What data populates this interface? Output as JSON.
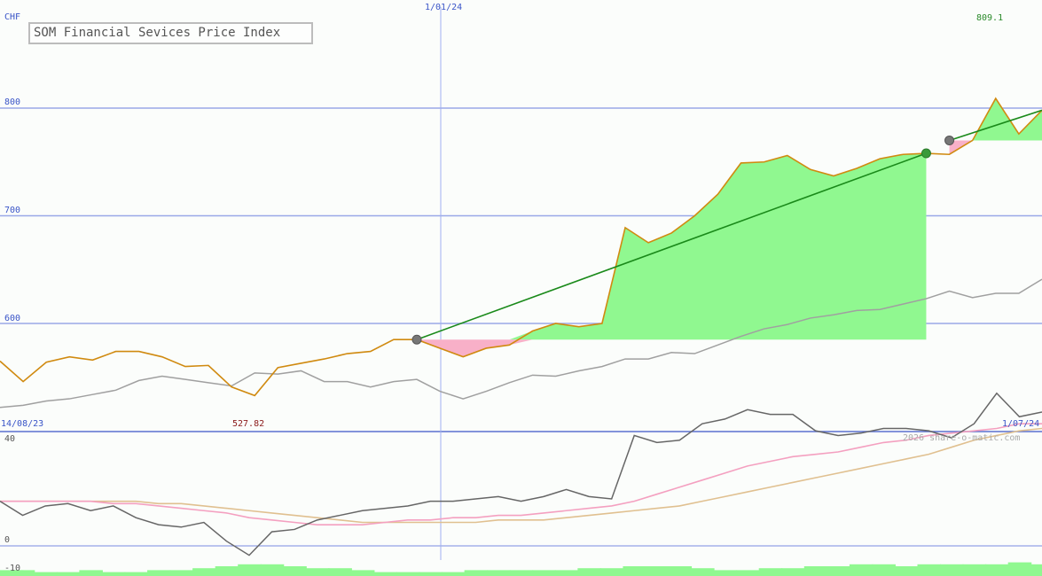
{
  "chart_data": {
    "type": "line",
    "title": "SOM Financial Sevices Price Index",
    "currency": "CHF",
    "watermark": "2026 share-o-matic.com",
    "x_start_label": "14/08/23",
    "x_mid_label": "1/01/24",
    "x_end_label": "1/07/24",
    "low_label": "527.82",
    "high_label": "809.1",
    "price_panel": {
      "y_ticks": [
        "600",
        "700",
        "800"
      ],
      "ylim": [
        504,
        900
      ],
      "price": [
        565,
        546,
        564,
        569,
        566,
        574,
        574,
        569,
        560,
        561,
        541,
        533,
        559,
        563,
        567,
        572,
        574,
        585,
        585,
        577,
        569,
        577,
        580,
        593,
        600,
        597,
        600,
        689,
        675,
        684,
        700,
        720,
        749,
        750,
        756,
        743,
        737,
        744,
        753,
        757,
        758,
        757,
        770,
        809,
        776,
        798
      ],
      "comparison": [
        522,
        524,
        528,
        530,
        534,
        538,
        547,
        551,
        548,
        545,
        542,
        554,
        553,
        556,
        546,
        546,
        541,
        546,
        548,
        537,
        530,
        537,
        545,
        552,
        551,
        556,
        560,
        567,
        567,
        573,
        572,
        580,
        588,
        595,
        599,
        605,
        608,
        612,
        613,
        618,
        623,
        630,
        624,
        628,
        628,
        641
      ],
      "trend_segments": [
        {
          "from_index": 18,
          "to_index": 40,
          "from": 585,
          "to": 758
        },
        {
          "from_index": 41,
          "to_index": 45,
          "from": 770,
          "to": 798
        }
      ]
    },
    "indicator_panel": {
      "y_ticks": [
        "40",
        "0",
        "-10"
      ],
      "oscillator": [
        19,
        13,
        17,
        18,
        15,
        17,
        12,
        9,
        8,
        10,
        2,
        -4,
        6,
        7,
        11,
        13,
        15,
        16,
        17,
        19,
        19,
        20,
        21,
        19,
        21,
        24,
        21,
        20,
        47,
        44,
        45,
        52,
        54,
        58,
        56,
        56,
        49,
        47,
        48,
        50,
        50,
        49,
        46,
        52,
        65,
        55,
        57
      ],
      "signal_fast": [
        19,
        19,
        19,
        19,
        19,
        18,
        18,
        17,
        16,
        15,
        14,
        12,
        11,
        10,
        9,
        9,
        9,
        10,
        11,
        11,
        12,
        12,
        13,
        13,
        14,
        15,
        16,
        17,
        19,
        22,
        25,
        28,
        31,
        34,
        36,
        38,
        39,
        40,
        42,
        44,
        45,
        47,
        48,
        49,
        50,
        52,
        52
      ],
      "signal_slow": [
        19,
        19,
        19,
        19,
        19,
        19,
        19,
        18,
        18,
        17,
        16,
        15,
        14,
        13,
        12,
        11,
        10,
        10,
        10,
        10,
        10,
        10,
        11,
        11,
        11,
        12,
        13,
        14,
        15,
        16,
        17,
        19,
        21,
        23,
        25,
        27,
        29,
        31,
        33,
        35,
        37,
        39,
        42,
        45,
        47,
        49,
        50
      ],
      "histogram": [
        -3,
        -3,
        -2,
        -2,
        -3,
        -2,
        -2,
        -3,
        -3,
        -4,
        -5,
        -6,
        -6,
        -5,
        -4,
        -4,
        -3,
        -2,
        -2,
        -2,
        -2,
        -3,
        -3,
        -3,
        -3,
        -3,
        -4,
        -4,
        -5,
        -5,
        -5,
        -4,
        -3,
        -3,
        -4,
        -4,
        -5,
        -5,
        -6,
        -6,
        -5,
        -6,
        -6,
        -6,
        -6,
        -7,
        -6
      ],
      "ylim": [
        -10,
        42
      ]
    }
  }
}
